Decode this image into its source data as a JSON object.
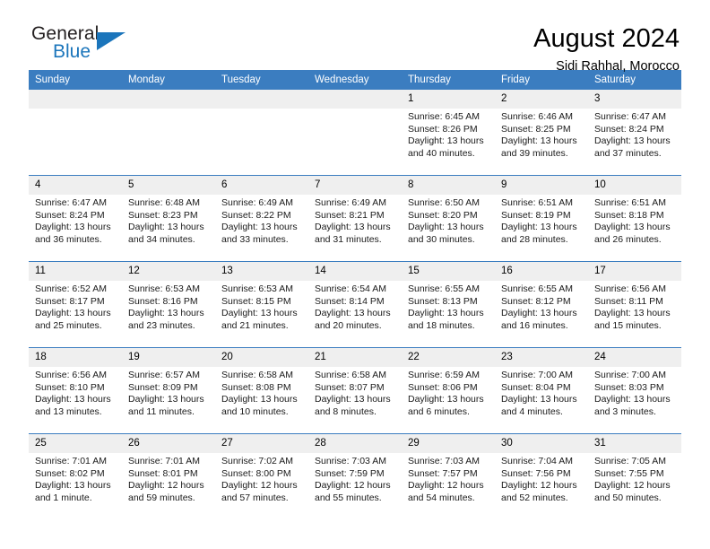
{
  "brand": {
    "name_top": "General",
    "name_bottom": "Blue"
  },
  "header": {
    "title": "August 2024",
    "subtitle": "Sidi Rahhal, Morocco"
  },
  "colors": {
    "header_blue": "#3b7dc0",
    "brand_blue": "#1b75bb",
    "daynum_band": "#efefef"
  },
  "weekday_headers": [
    "Sunday",
    "Monday",
    "Tuesday",
    "Wednesday",
    "Thursday",
    "Friday",
    "Saturday"
  ],
  "weeks": [
    [
      {
        "day": "",
        "sunrise": "",
        "sunset": "",
        "daylight": ""
      },
      {
        "day": "",
        "sunrise": "",
        "sunset": "",
        "daylight": ""
      },
      {
        "day": "",
        "sunrise": "",
        "sunset": "",
        "daylight": ""
      },
      {
        "day": "",
        "sunrise": "",
        "sunset": "",
        "daylight": ""
      },
      {
        "day": "1",
        "sunrise": "Sunrise: 6:45 AM",
        "sunset": "Sunset: 8:26 PM",
        "daylight": "Daylight: 13 hours and 40 minutes."
      },
      {
        "day": "2",
        "sunrise": "Sunrise: 6:46 AM",
        "sunset": "Sunset: 8:25 PM",
        "daylight": "Daylight: 13 hours and 39 minutes."
      },
      {
        "day": "3",
        "sunrise": "Sunrise: 6:47 AM",
        "sunset": "Sunset: 8:24 PM",
        "daylight": "Daylight: 13 hours and 37 minutes."
      }
    ],
    [
      {
        "day": "4",
        "sunrise": "Sunrise: 6:47 AM",
        "sunset": "Sunset: 8:24 PM",
        "daylight": "Daylight: 13 hours and 36 minutes."
      },
      {
        "day": "5",
        "sunrise": "Sunrise: 6:48 AM",
        "sunset": "Sunset: 8:23 PM",
        "daylight": "Daylight: 13 hours and 34 minutes."
      },
      {
        "day": "6",
        "sunrise": "Sunrise: 6:49 AM",
        "sunset": "Sunset: 8:22 PM",
        "daylight": "Daylight: 13 hours and 33 minutes."
      },
      {
        "day": "7",
        "sunrise": "Sunrise: 6:49 AM",
        "sunset": "Sunset: 8:21 PM",
        "daylight": "Daylight: 13 hours and 31 minutes."
      },
      {
        "day": "8",
        "sunrise": "Sunrise: 6:50 AM",
        "sunset": "Sunset: 8:20 PM",
        "daylight": "Daylight: 13 hours and 30 minutes."
      },
      {
        "day": "9",
        "sunrise": "Sunrise: 6:51 AM",
        "sunset": "Sunset: 8:19 PM",
        "daylight": "Daylight: 13 hours and 28 minutes."
      },
      {
        "day": "10",
        "sunrise": "Sunrise: 6:51 AM",
        "sunset": "Sunset: 8:18 PM",
        "daylight": "Daylight: 13 hours and 26 minutes."
      }
    ],
    [
      {
        "day": "11",
        "sunrise": "Sunrise: 6:52 AM",
        "sunset": "Sunset: 8:17 PM",
        "daylight": "Daylight: 13 hours and 25 minutes."
      },
      {
        "day": "12",
        "sunrise": "Sunrise: 6:53 AM",
        "sunset": "Sunset: 8:16 PM",
        "daylight": "Daylight: 13 hours and 23 minutes."
      },
      {
        "day": "13",
        "sunrise": "Sunrise: 6:53 AM",
        "sunset": "Sunset: 8:15 PM",
        "daylight": "Daylight: 13 hours and 21 minutes."
      },
      {
        "day": "14",
        "sunrise": "Sunrise: 6:54 AM",
        "sunset": "Sunset: 8:14 PM",
        "daylight": "Daylight: 13 hours and 20 minutes."
      },
      {
        "day": "15",
        "sunrise": "Sunrise: 6:55 AM",
        "sunset": "Sunset: 8:13 PM",
        "daylight": "Daylight: 13 hours and 18 minutes."
      },
      {
        "day": "16",
        "sunrise": "Sunrise: 6:55 AM",
        "sunset": "Sunset: 8:12 PM",
        "daylight": "Daylight: 13 hours and 16 minutes."
      },
      {
        "day": "17",
        "sunrise": "Sunrise: 6:56 AM",
        "sunset": "Sunset: 8:11 PM",
        "daylight": "Daylight: 13 hours and 15 minutes."
      }
    ],
    [
      {
        "day": "18",
        "sunrise": "Sunrise: 6:56 AM",
        "sunset": "Sunset: 8:10 PM",
        "daylight": "Daylight: 13 hours and 13 minutes."
      },
      {
        "day": "19",
        "sunrise": "Sunrise: 6:57 AM",
        "sunset": "Sunset: 8:09 PM",
        "daylight": "Daylight: 13 hours and 11 minutes."
      },
      {
        "day": "20",
        "sunrise": "Sunrise: 6:58 AM",
        "sunset": "Sunset: 8:08 PM",
        "daylight": "Daylight: 13 hours and 10 minutes."
      },
      {
        "day": "21",
        "sunrise": "Sunrise: 6:58 AM",
        "sunset": "Sunset: 8:07 PM",
        "daylight": "Daylight: 13 hours and 8 minutes."
      },
      {
        "day": "22",
        "sunrise": "Sunrise: 6:59 AM",
        "sunset": "Sunset: 8:06 PM",
        "daylight": "Daylight: 13 hours and 6 minutes."
      },
      {
        "day": "23",
        "sunrise": "Sunrise: 7:00 AM",
        "sunset": "Sunset: 8:04 PM",
        "daylight": "Daylight: 13 hours and 4 minutes."
      },
      {
        "day": "24",
        "sunrise": "Sunrise: 7:00 AM",
        "sunset": "Sunset: 8:03 PM",
        "daylight": "Daylight: 13 hours and 3 minutes."
      }
    ],
    [
      {
        "day": "25",
        "sunrise": "Sunrise: 7:01 AM",
        "sunset": "Sunset: 8:02 PM",
        "daylight": "Daylight: 13 hours and 1 minute."
      },
      {
        "day": "26",
        "sunrise": "Sunrise: 7:01 AM",
        "sunset": "Sunset: 8:01 PM",
        "daylight": "Daylight: 12 hours and 59 minutes."
      },
      {
        "day": "27",
        "sunrise": "Sunrise: 7:02 AM",
        "sunset": "Sunset: 8:00 PM",
        "daylight": "Daylight: 12 hours and 57 minutes."
      },
      {
        "day": "28",
        "sunrise": "Sunrise: 7:03 AM",
        "sunset": "Sunset: 7:59 PM",
        "daylight": "Daylight: 12 hours and 55 minutes."
      },
      {
        "day": "29",
        "sunrise": "Sunrise: 7:03 AM",
        "sunset": "Sunset: 7:57 PM",
        "daylight": "Daylight: 12 hours and 54 minutes."
      },
      {
        "day": "30",
        "sunrise": "Sunrise: 7:04 AM",
        "sunset": "Sunset: 7:56 PM",
        "daylight": "Daylight: 12 hours and 52 minutes."
      },
      {
        "day": "31",
        "sunrise": "Sunrise: 7:05 AM",
        "sunset": "Sunset: 7:55 PM",
        "daylight": "Daylight: 12 hours and 50 minutes."
      }
    ]
  ]
}
